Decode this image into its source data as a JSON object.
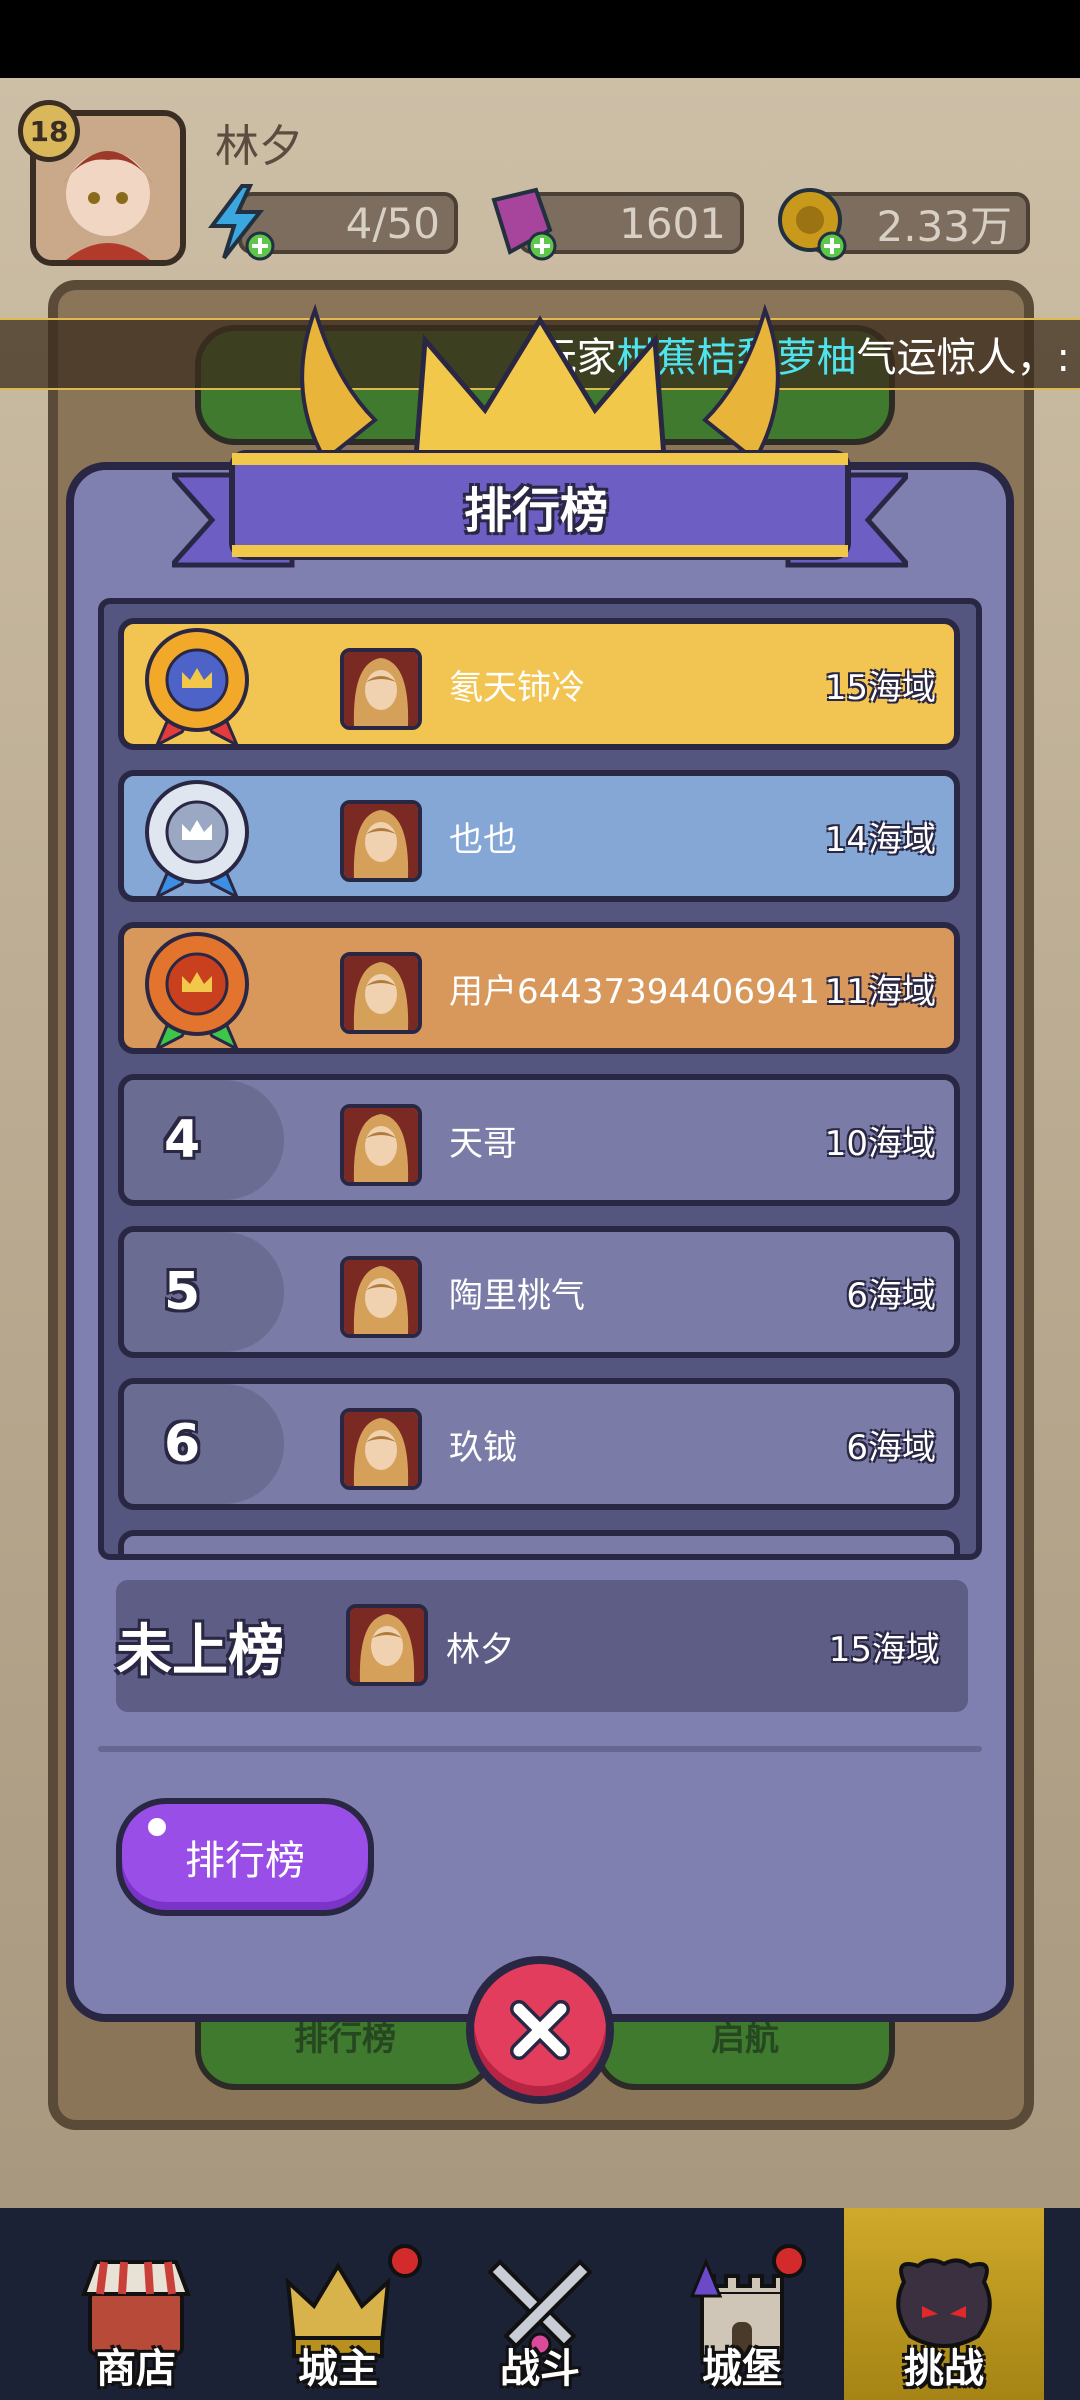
{
  "header": {
    "level": "18",
    "player_name": "林夕",
    "energy": "4/50",
    "gems": "1601",
    "coins": "2.33万"
  },
  "marquee": {
    "prefix": "玩家",
    "highlight": "柑蕉桔梨萝柚",
    "suffix": "气运惊人，:"
  },
  "background": {
    "btn_left": "排行榜",
    "btn_right": "启航"
  },
  "modal": {
    "title": "排行榜",
    "rows": [
      {
        "rank": "1",
        "name": "氡天铈冷",
        "score": "15海域",
        "color": "#f2c451",
        "medal": "gold"
      },
      {
        "rank": "2",
        "name": "也也",
        "score": "14海域",
        "color": "#84a7d6",
        "medal": "silver"
      },
      {
        "rank": "3",
        "name": "用户64437394406941",
        "score": "11海域",
        "color": "#d8985b",
        "medal": "bronze"
      },
      {
        "rank": "4",
        "name": "天哥",
        "score": "10海域",
        "color": "#7a7ba6",
        "medal": ""
      },
      {
        "rank": "5",
        "name": "陶里桃气",
        "score": "6海域",
        "color": "#7a7ba6",
        "medal": ""
      },
      {
        "rank": "6",
        "name": "玖钺",
        "score": "6海域",
        "color": "#7a7ba6",
        "medal": ""
      }
    ],
    "my_rank_label": "未上榜",
    "my_name": "林夕",
    "my_score": "15海域",
    "rank_button": "排行榜"
  },
  "nav": {
    "items": [
      {
        "label": "商店",
        "icon": "shop-icon"
      },
      {
        "label": "城主",
        "icon": "crown-icon"
      },
      {
        "label": "战斗",
        "icon": "swords-icon"
      },
      {
        "label": "城堡",
        "icon": "castle-icon"
      },
      {
        "label": "挑战",
        "icon": "demon-icon"
      }
    ]
  }
}
